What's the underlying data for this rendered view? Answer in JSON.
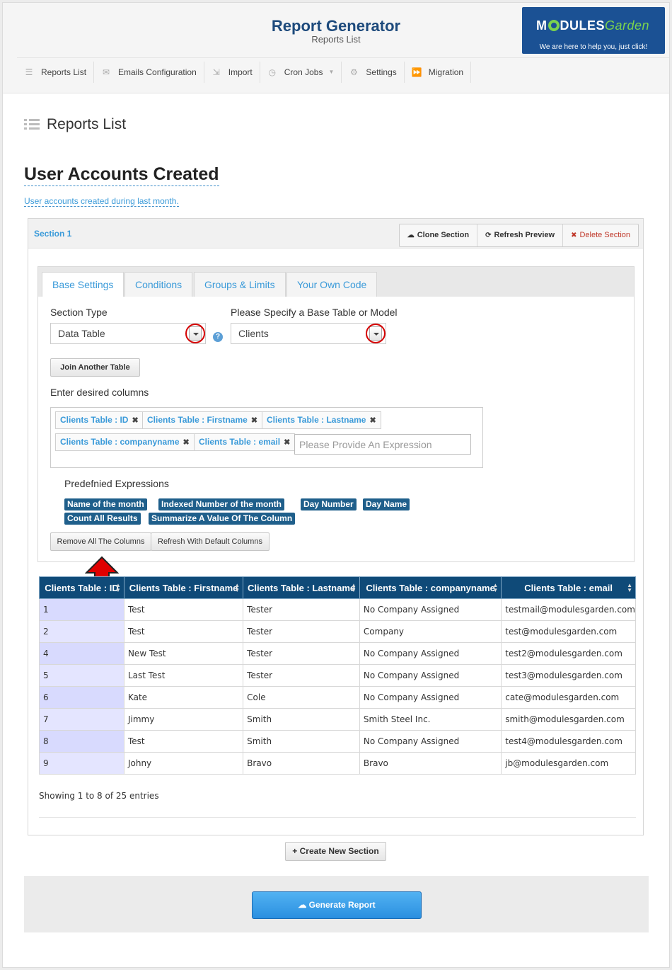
{
  "header": {
    "title": "Report Generator",
    "subtitle": "Reports List",
    "logo": {
      "brand_pre": "M",
      "brand_mid": "DULES",
      "brand_garden": "Garden",
      "tagline": "We are here to help you, just click!"
    }
  },
  "nav": [
    {
      "label": "Reports List",
      "icon": "list-icon"
    },
    {
      "label": "Emails Configuration",
      "icon": "envelope-icon"
    },
    {
      "label": "Import",
      "icon": "import-icon"
    },
    {
      "label": "Cron Jobs",
      "icon": "clock-icon"
    },
    {
      "label": "Settings",
      "icon": "gears-icon"
    },
    {
      "label": "Migration",
      "icon": "forward-icon"
    }
  ],
  "page": {
    "heading": "Reports List",
    "report_name": "User Accounts Created",
    "report_description": "User accounts created during last month."
  },
  "section": {
    "name": "Section 1",
    "buttons": {
      "clone": "Clone Section",
      "refresh": "Refresh Preview",
      "delete": "Delete Section"
    },
    "tabs": [
      "Base Settings",
      "Conditions",
      "Groups & Limits",
      "Your Own Code"
    ],
    "section_type_label": "Section Type",
    "section_type_value": "Data Table",
    "base_table_label": "Please Specify a Base Table or Model",
    "base_table_value": "Clients",
    "help_icon_text": "?",
    "join_button": "Join Another Table",
    "columns_label": "Enter desired columns",
    "columns": [
      "Clients Table : ID",
      "Clients Table : Firstname",
      "Clients Table : Lastname",
      "Clients Table : companyname",
      "Clients Table : email"
    ],
    "expression_placeholder": "Please Provide An Expression",
    "predefined_label": "Predefnied Expressions",
    "predefined": [
      "Name of the month",
      "Indexed Number of the month",
      "Day Number",
      "Day Name",
      "Count All Results",
      "Summarize A Value Of The Column"
    ],
    "remove_all": "Remove All The Columns",
    "refresh_default": "Refresh With Default Columns"
  },
  "table": {
    "headers": [
      "Clients Table : ID",
      "Clients Table : Firstname",
      "Clients Table : Lastname",
      "Clients Table : companyname",
      "Clients Table : email"
    ],
    "rows": [
      [
        "1",
        "Test",
        "Tester",
        "No Company Assigned",
        "testmail@modulesgarden.com"
      ],
      [
        "2",
        "Test",
        "Tester",
        "Company",
        "test@modulesgarden.com"
      ],
      [
        "4",
        "New Test",
        "Tester",
        "No Company Assigned",
        "test2@modulesgarden.com"
      ],
      [
        "5",
        "Last Test",
        "Tester",
        "No Company Assigned",
        "test3@modulesgarden.com"
      ],
      [
        "6",
        "Kate",
        "Cole",
        "No Company Assigned",
        "cate@modulesgarden.com"
      ],
      [
        "7",
        "Jimmy",
        "Smith",
        "Smith Steel Inc.",
        "smith@modulesgarden.com"
      ],
      [
        "8",
        "Test",
        "Smith",
        "No Company Assigned",
        "test4@modulesgarden.com"
      ],
      [
        "9",
        "Johny",
        "Bravo",
        "Bravo",
        "jb@modulesgarden.com"
      ]
    ],
    "showing": "Showing 1 to 8 of 25 entries"
  },
  "actions": {
    "create_section": "Create New Section",
    "generate_report": "Generate Report"
  },
  "colors": {
    "header_title": "#1d4a7c",
    "link_blue": "#3a9ad9",
    "table_header": "#0f4a78",
    "expression_tag": "#1f5f8b",
    "generate_button": "#2a8fe0",
    "highlight_ring": "#d40000",
    "annotation_arrow": "#e00000"
  }
}
